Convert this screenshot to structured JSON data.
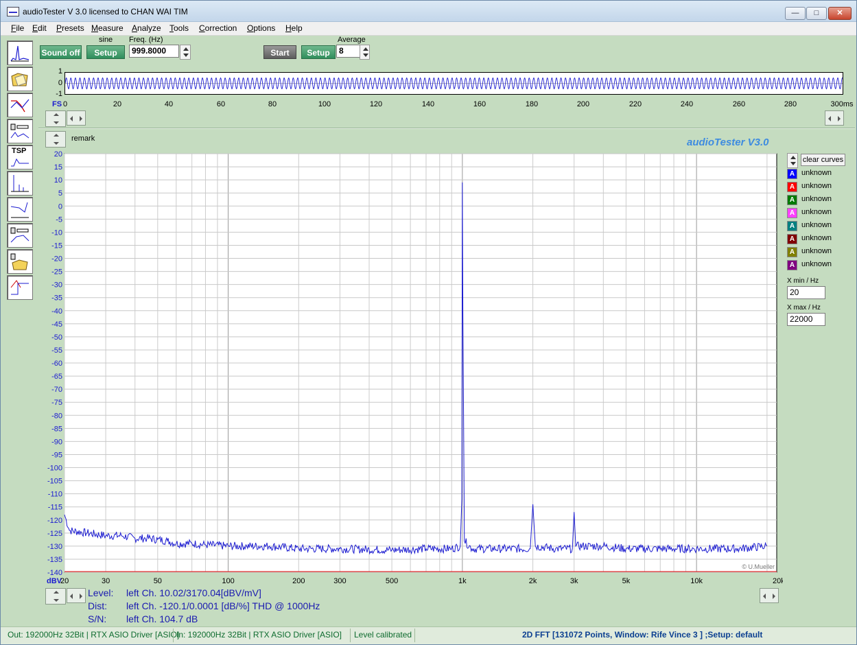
{
  "window": {
    "title": "audioTester  V 3.0   licensed to CHAN WAI TIM",
    "min_glyph": "—",
    "max_glyph": "□",
    "close_glyph": "✕"
  },
  "menu": [
    "File",
    "Edit",
    "Presets",
    "Measure",
    "Analyze",
    "Tools",
    "Correction",
    "Options",
    "Help"
  ],
  "toolbox": {
    "tsp_label": "TSP",
    "icons": [
      "fft-spectrum-icon",
      "folder-open-icon",
      "frequency-response-icon",
      "impedance-icon",
      "tsp-icon",
      "harmonic-icon",
      "bode-icon",
      "speaker-measure-icon",
      "speaker-folder-icon",
      "step-response-icon"
    ]
  },
  "generator": {
    "sound_label": "Sound off",
    "waveform_label": "sine",
    "setup_label": "Setup",
    "freq_label": "Freq. (Hz)",
    "freq_value": "999.8000"
  },
  "acquisition": {
    "start_label": "Start",
    "setup_label": "Setup",
    "average_label": "Average",
    "average_value": "8"
  },
  "scope": {
    "y_ticks": [
      "1",
      "0",
      "-1"
    ],
    "fs_label": "FS",
    "x_ticks": [
      "0",
      "20",
      "40",
      "60",
      "80",
      "100",
      "120",
      "140",
      "160",
      "180",
      "200",
      "220",
      "240",
      "260",
      "280",
      "300ms"
    ]
  },
  "fft": {
    "remark": "remark",
    "brand": "audioTester  V3.0",
    "copyright": "© U.Mueller",
    "y_unit": "dBV",
    "x_unit_label": "20kHz",
    "clear_label": "clear curves",
    "xmin_label": "X min / Hz",
    "xmin_value": "20",
    "xmax_label": "X max / Hz",
    "xmax_value": "22000"
  },
  "chart_data": {
    "type": "line",
    "xlabel": "",
    "ylabel": "dBV",
    "x_scale": "log",
    "xlim": [
      20,
      22000
    ],
    "ylim": [
      -140,
      20
    ],
    "y_ticks": [
      20,
      15,
      10,
      5,
      0,
      -5,
      -10,
      -15,
      -20,
      -25,
      -30,
      -35,
      -40,
      -45,
      -50,
      -55,
      -60,
      -65,
      -70,
      -75,
      -80,
      -85,
      -90,
      -95,
      -100,
      -105,
      -110,
      -115,
      -120,
      -125,
      -130,
      -135,
      -140
    ],
    "x_tick_labels": [
      {
        "v": 30,
        "t": "30"
      },
      {
        "v": 50,
        "t": "50"
      },
      {
        "v": 100,
        "t": "100"
      },
      {
        "v": 200,
        "t": "200"
      },
      {
        "v": 300,
        "t": "300"
      },
      {
        "v": 500,
        "t": "500"
      },
      {
        "v": 1000,
        "t": "1k"
      },
      {
        "v": 2000,
        "t": "2k"
      },
      {
        "v": 3000,
        "t": "3k"
      },
      {
        "v": 5000,
        "t": "5k"
      },
      {
        "v": 10000,
        "t": "10k"
      }
    ],
    "grid": true,
    "series": [
      {
        "color": "#1b1bd0",
        "x": [
          20,
          21,
          25,
          30,
          35,
          40,
          45,
          50,
          55,
          60,
          70,
          80,
          100,
          120,
          150,
          200,
          300,
          500,
          700,
          900,
          980,
          995,
          1000,
          1005,
          1020,
          1100,
          1500,
          1950,
          2000,
          2050,
          2500,
          2950,
          3000,
          3050,
          4000,
          5000,
          8000,
          10000,
          15000,
          20000
        ],
        "y": [
          -118,
          -124,
          -125,
          -126,
          -126,
          -127,
          -127,
          -127.5,
          -128,
          -129,
          -129,
          -129.5,
          -130,
          -130,
          -130,
          -131,
          -131,
          -131.5,
          -131,
          -131,
          -130,
          -112,
          9,
          -40,
          -128,
          -131,
          -131,
          -131,
          -114,
          -130,
          -131,
          -131,
          -117,
          -130,
          -130,
          -131,
          -131,
          -131,
          -131,
          -130
        ]
      }
    ]
  },
  "results": {
    "level_label": "Level:",
    "level_value": "left Ch. 10.02/3170.04[dBV/mV]",
    "dist_label": "Dist:",
    "dist_value": "left Ch. -120.1/0.0001 [dB/%] THD @ 1000Hz",
    "sn_label": "S/N:",
    "sn_value": "left Ch. 104.7 dB"
  },
  "legend": [
    {
      "label": "unknown",
      "color": "#0000ff",
      "glyph": "A"
    },
    {
      "label": "unknown",
      "color": "#ff0000",
      "glyph": "A"
    },
    {
      "label": "unknown",
      "color": "#007a00",
      "glyph": "A"
    },
    {
      "label": "unknown",
      "color": "#ff40ff",
      "glyph": "A"
    },
    {
      "label": "unknown",
      "color": "#008080",
      "glyph": "A"
    },
    {
      "label": "unknown",
      "color": "#800000",
      "glyph": "A"
    },
    {
      "label": "unknown",
      "color": "#808000",
      "glyph": "A"
    },
    {
      "label": "unknown",
      "color": "#800080",
      "glyph": "A"
    }
  ],
  "status": {
    "out": "Out: 192000Hz 32Bit   | RTX ASIO Driver [ASIO]",
    "in": "In: 192000Hz 32Bit   | RTX ASIO Driver [ASIO]",
    "calib": "Level calibrated",
    "mode": "2D FFT [131072 Points, Window: Rife Vince 3 ]  ;Setup:  default"
  }
}
